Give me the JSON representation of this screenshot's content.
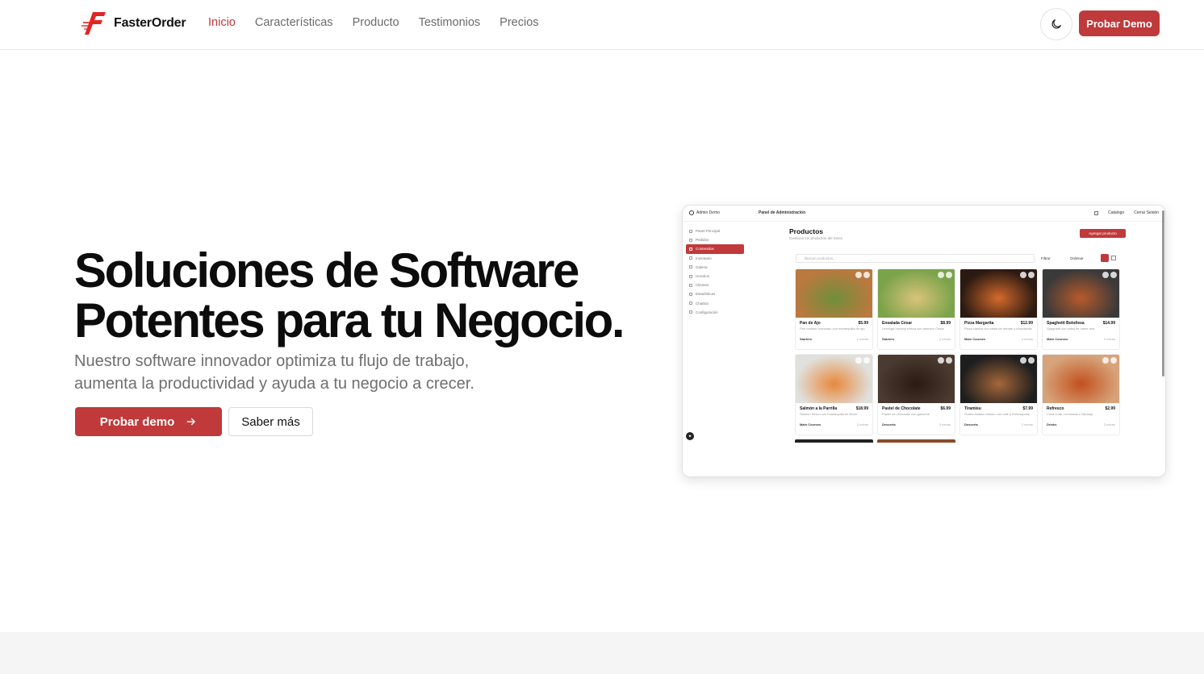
{
  "brand": {
    "name": "FasterOrder",
    "color": "#c0393b"
  },
  "nav": {
    "items": [
      "Inicio",
      "Características",
      "Producto",
      "Testimonios",
      "Precios"
    ],
    "active": "Inicio"
  },
  "header": {
    "theme_icon": "moon-icon",
    "demo_label": "Probar Demo"
  },
  "hero": {
    "title_line1": "Soluciones de Software",
    "title_line2": "Potentes para tu Negocio.",
    "subtitle_line1": "Nuestro software innovador optimiza tu flujo de trabajo,",
    "subtitle_line2": "aumenta la productividad y ayuda a tu negocio a crecer.",
    "primary_label": "Probar demo",
    "secondary_label": "Saber más"
  },
  "screenshot": {
    "admin": "Admin Demo",
    "panel_title": "Panel de Administración",
    "catalog": "Catalogo",
    "logout": "Cerrar Sesión",
    "sidebar": [
      "Panel Principal",
      "Pedidos",
      "Contenidos",
      "Inventario",
      "Galeria",
      "Horarios",
      "Clientes",
      "Estadísticas",
      "Chatbot",
      "Configuración"
    ],
    "sidebar_active": "Contenidos",
    "heading": "Productos",
    "heading_sub": "Gestiona tus productos del menú",
    "add_label": "Agregar producto",
    "search_placeholder": "Buscar productos...",
    "filter_label": "Filtrar",
    "order_label": "Ordenar",
    "products": [
      {
        "name": "Pan de Ajo",
        "price": "$5.99",
        "desc": "Pan tostado horneado con mantequilla de ajo",
        "tag": "Starters",
        "count": "2 extras",
        "color": "#b9793f",
        "color2": "#6f8f3a"
      },
      {
        "name": "Ensalada César",
        "price": "$8.99",
        "desc": "Lechuga romana fresca con aderezo César",
        "tag": "Starters",
        "count": "2 extras",
        "color": "#7aa34a",
        "color2": "#d9c37a"
      },
      {
        "name": "Pizza Margarita",
        "price": "$12.99",
        "desc": "Pizza clásica con salsa de tomate y mozzarella",
        "tag": "Main Courses",
        "count": "4 extras",
        "color": "#2b1a12",
        "color2": "#d46a2b"
      },
      {
        "name": "Spaghetti Boloñesa",
        "price": "$14.99",
        "desc": "Spaghetti con salsa de carne rica",
        "tag": "Main Courses",
        "count": "3 extras",
        "color": "#3a3a3a",
        "color2": "#b85a2a"
      },
      {
        "name": "Salmón a la Parrilla",
        "price": "$18.99",
        "desc": "Salmón fresco con mantequilla de limón",
        "tag": "Main Courses",
        "count": "3 extras",
        "color": "#e0e0dc",
        "color2": "#e8883c"
      },
      {
        "name": "Pastel de Chocolate",
        "price": "$6.99",
        "desc": "Pastel de chocolate con ganache",
        "tag": "Desserts",
        "count": "3 extras",
        "color": "#4a3a30",
        "color2": "#2a1a12"
      },
      {
        "name": "Tiramisu",
        "price": "$7.99",
        "desc": "Postre italiano clásico con café y mascarpone",
        "tag": "Desserts",
        "count": "2 extras",
        "color": "#1e1e1e",
        "color2": "#a5673a"
      },
      {
        "name": "Refresco",
        "price": "$2.99",
        "desc": "Coca-Cola, Limonada o Naranja",
        "tag": "Drinks",
        "count": "3 extras",
        "color": "#d7a37a",
        "color2": "#c2501e"
      }
    ]
  }
}
